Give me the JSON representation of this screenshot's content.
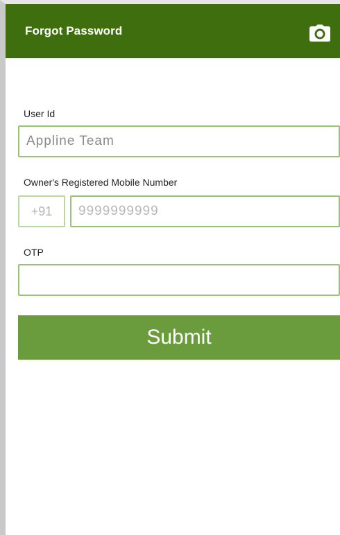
{
  "app_bar": {
    "title": "Forgot Password",
    "background_color": "#3f6e0f",
    "action_icon": "camera-icon"
  },
  "form": {
    "user_id": {
      "label": "User Id",
      "placeholder": "Appline Team",
      "value": ""
    },
    "mobile": {
      "label": "Owner's Registered Mobile Number",
      "country_code": "+91",
      "placeholder": "9999999999",
      "value": ""
    },
    "otp": {
      "label": "OTP",
      "placeholder": "",
      "value": ""
    },
    "submit_label": "Submit",
    "accent_color": "#6a9c3e",
    "field_border_color": "#98c472"
  }
}
